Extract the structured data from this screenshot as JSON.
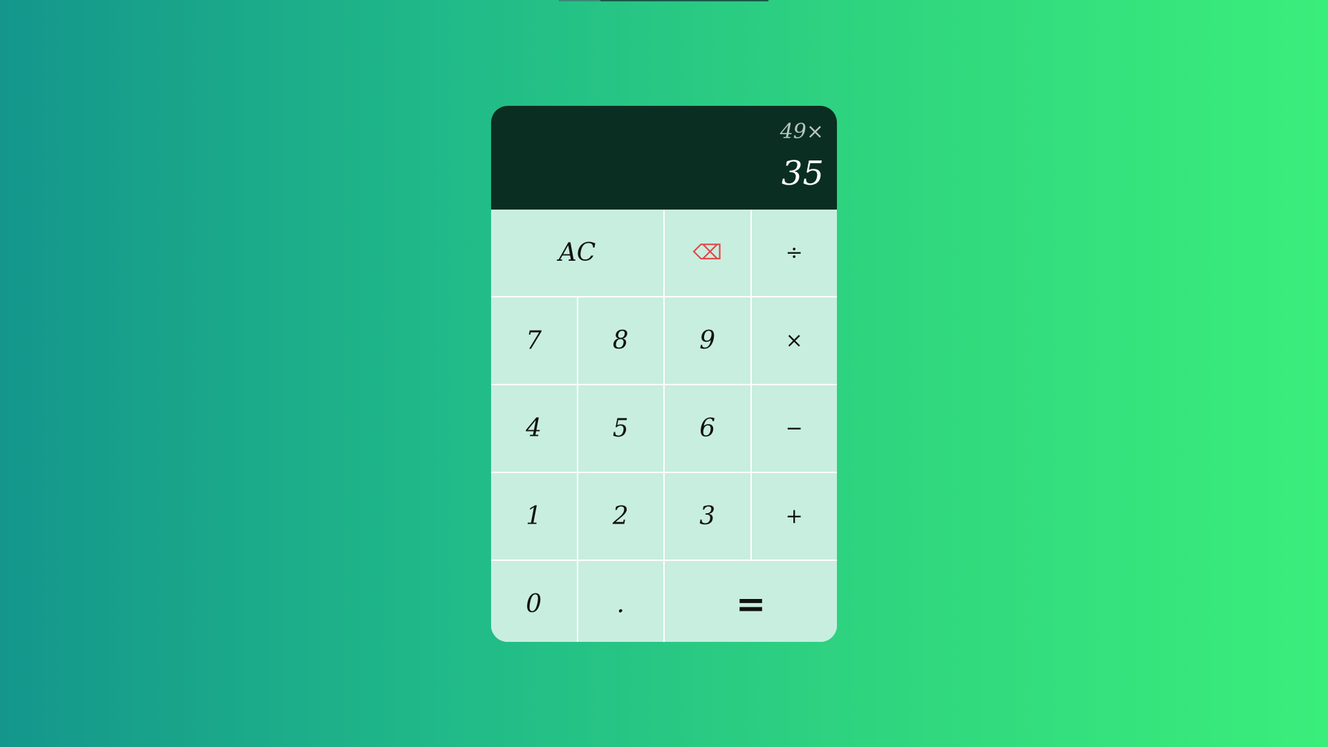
{
  "display": {
    "previous": "49×",
    "current": "35"
  },
  "keys": {
    "clear": "AC",
    "backspace": "⌫",
    "divide": "÷",
    "seven": "7",
    "eight": "8",
    "nine": "9",
    "multiply": "×",
    "four": "4",
    "five": "5",
    "six": "6",
    "subtract": "−",
    "one": "1",
    "two": "2",
    "three": "3",
    "add": "+",
    "zero": "0",
    "decimal": ".",
    "equals": "="
  },
  "colors": {
    "display_background": "#0a2e22",
    "key_background": "#c8eee0",
    "backspace": "#e04848",
    "gradient_start": "#14968c",
    "gradient_end": "#3aee7b"
  }
}
